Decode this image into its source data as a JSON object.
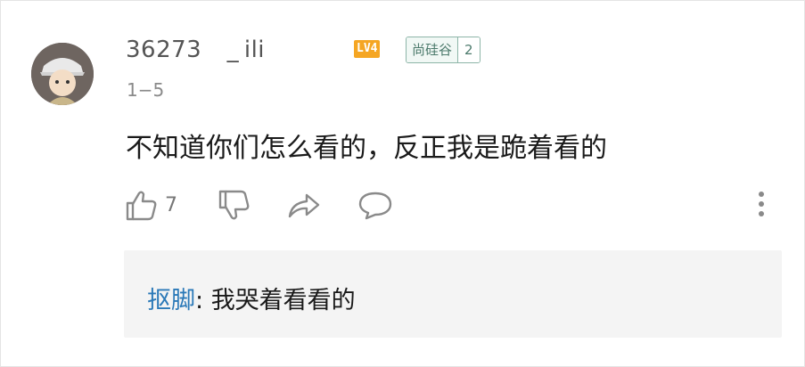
{
  "comment": {
    "username": "36273     _ ili",
    "level_badge": "LV4",
    "medal": {
      "name": "尚硅谷",
      "level": "2"
    },
    "floor": "1−5",
    "content": "不知道你们怎么看的，反正我是跪着看的",
    "likes": "7",
    "icons": [
      "thumbs-up-icon",
      "thumbs-down-icon",
      "share-icon",
      "reply-icon",
      "more-vertical-icon"
    ]
  },
  "reply": {
    "user": "抠脚",
    "separator": ": ",
    "text": "我哭着看看的"
  },
  "colors": {
    "username": "#555555",
    "level_badge": "#f5a623",
    "medal_border": "#8db5a8",
    "reply_user": "#2b79b8",
    "reply_bg": "#f4f4f4"
  }
}
